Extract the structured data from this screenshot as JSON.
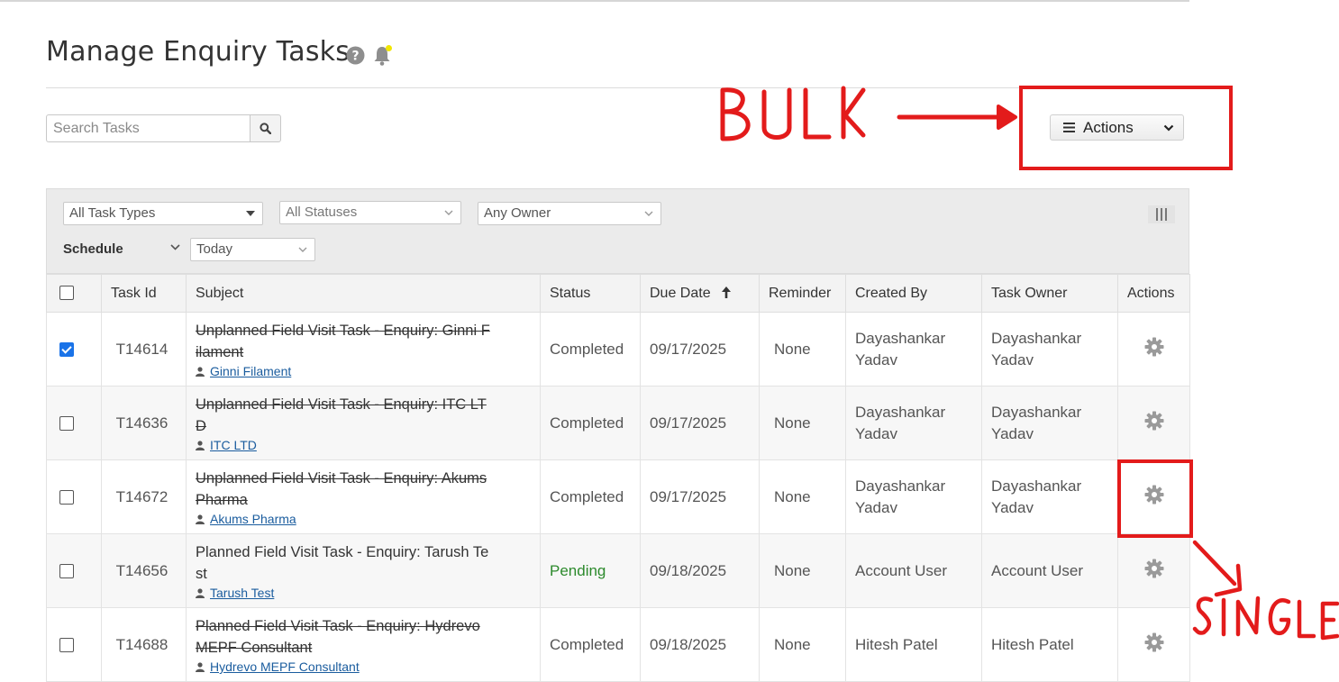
{
  "header": {
    "title": "Manage Enquiry Tasks"
  },
  "search": {
    "placeholder": "Search Tasks"
  },
  "bulk_actions": {
    "label": "Actions"
  },
  "filters": {
    "task_type": "All Task Types",
    "status": "All Statuses",
    "owner": "Any Owner",
    "schedule_label": "Schedule",
    "schedule_value": "Today"
  },
  "table": {
    "columns": [
      "Task Id",
      "Subject",
      "Status",
      "Due Date",
      "Reminder",
      "Created By",
      "Task Owner",
      "Actions"
    ],
    "rows": [
      {
        "checked": true,
        "id": "T14614",
        "subject_l1": "Unplanned Field Visit Task - Enquiry: Ginni F",
        "subject_l2": "ilament",
        "completed": true,
        "related": "Ginni Filament",
        "status": "Completed",
        "due": "09/17/2025",
        "reminder": "None",
        "created_by_l1": "Dayashankar",
        "created_by_l2": "Yadav",
        "owner_l1": "Dayashankar",
        "owner_l2": "Yadav"
      },
      {
        "checked": false,
        "id": "T14636",
        "subject_l1": "Unplanned Field Visit Task - Enquiry: ITC LT",
        "subject_l2": "D",
        "completed": true,
        "related": "ITC LTD",
        "status": "Completed",
        "due": "09/17/2025",
        "reminder": "None",
        "created_by_l1": "Dayashankar",
        "created_by_l2": "Yadav",
        "owner_l1": "Dayashankar",
        "owner_l2": "Yadav"
      },
      {
        "checked": false,
        "id": "T14672",
        "subject_l1": "Unplanned Field Visit Task - Enquiry: Akums",
        "subject_l2": "Pharma",
        "completed": true,
        "related": "Akums Pharma",
        "status": "Completed",
        "due": "09/17/2025",
        "reminder": "None",
        "created_by_l1": "Dayashankar",
        "created_by_l2": "Yadav",
        "owner_l1": "Dayashankar",
        "owner_l2": "Yadav"
      },
      {
        "checked": false,
        "id": "T14656",
        "subject_l1": "Planned Field Visit Task - Enquiry: Tarush Te",
        "subject_l2": "st",
        "completed": false,
        "related": "Tarush Test",
        "status": "Pending",
        "due": "09/18/2025",
        "reminder": "None",
        "created_by_l1": "Account User",
        "created_by_l2": "",
        "owner_l1": "Account User",
        "owner_l2": ""
      },
      {
        "checked": false,
        "id": "T14688",
        "subject_l1": "Planned Field Visit Task - Enquiry: Hydrevo",
        "subject_l2": "MEPF Consultant",
        "completed": true,
        "related": "Hydrevo MEPF Consultant",
        "status": "Completed",
        "due": "09/18/2025",
        "reminder": "None",
        "created_by_l1": "Hitesh Patel",
        "created_by_l2": "",
        "owner_l1": "Hitesh Patel",
        "owner_l2": ""
      }
    ]
  },
  "annotations": {
    "bulk": "BULK",
    "single": "SINGLE",
    "color": "#e31b1b"
  },
  "colors": {
    "pending": "#2c8a2c",
    "link": "#1a5c9e",
    "checkbox_checked": "#1a73e8"
  },
  "icons": [
    "help-icon",
    "bell-icon",
    "search-icon",
    "menu-icon",
    "chevron-down-icon",
    "columns-icon",
    "user-icon",
    "gear-icon"
  ]
}
